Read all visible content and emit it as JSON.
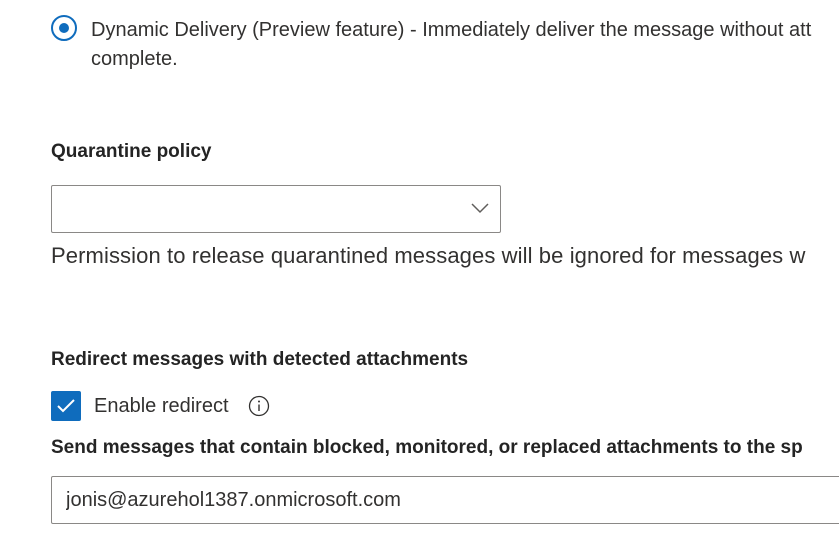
{
  "delivery": {
    "dynamic_delivery_line1": "Dynamic Delivery (Preview feature) - Immediately deliver the message without att",
    "dynamic_delivery_line2": "complete.",
    "selected": true
  },
  "quarantine": {
    "heading": "Quarantine policy",
    "selected_value": "",
    "permission_note": "Permission to release quarantined messages will be ignored for messages w"
  },
  "redirect": {
    "heading": "Redirect messages with detected attachments",
    "enable_label": "Enable redirect",
    "enabled": true,
    "send_label": "Send messages that contain blocked, monitored, or replaced attachments to the sp",
    "email_value": "jonis@azurehol1387.onmicrosoft.com"
  },
  "colors": {
    "accent": "#0f6cbd",
    "text": "#323130",
    "border": "#8a8886"
  },
  "icons": {
    "radio": "radio-selected-icon",
    "dropdown": "chevron-down-icon",
    "checkbox": "checkmark-icon",
    "info": "info-icon"
  }
}
